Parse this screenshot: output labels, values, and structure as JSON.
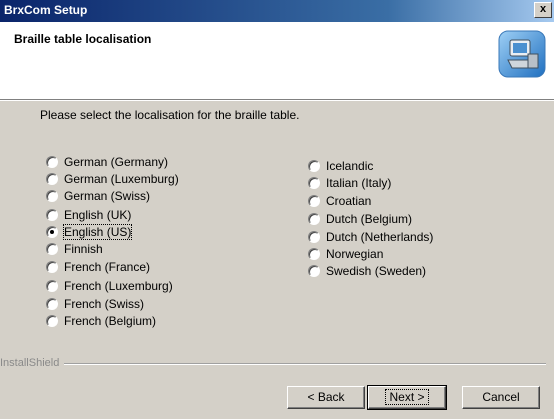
{
  "window": {
    "title": "BrxCom Setup",
    "close_label": "x"
  },
  "header": {
    "title": "Braille table localisation",
    "logo_icon": "installer-computer-icon"
  },
  "instruction": "Please select the localisation for the braille table.",
  "options_left": [
    {
      "label": "German (Germany)",
      "checked": false
    },
    {
      "label": "German (Luxemburg)",
      "checked": false
    },
    {
      "label": "German (Swiss)",
      "checked": false
    },
    {
      "label": "English (UK)",
      "checked": false
    },
    {
      "label": "English (US)",
      "checked": true
    },
    {
      "label": "Finnish",
      "checked": false
    },
    {
      "label": "French (France)",
      "checked": false
    },
    {
      "label": "French (Luxemburg)",
      "checked": false
    },
    {
      "label": "French (Swiss)",
      "checked": false
    },
    {
      "label": "French (Belgium)",
      "checked": false
    }
  ],
  "options_right": [
    {
      "label": "Icelandic",
      "checked": false
    },
    {
      "label": "Italian (Italy)",
      "checked": false
    },
    {
      "label": "Croatian",
      "checked": false
    },
    {
      "label": "Dutch (Belgium)",
      "checked": false
    },
    {
      "label": "Dutch (Netherlands)",
      "checked": false
    },
    {
      "label": "Norwegian",
      "checked": false
    },
    {
      "label": "Swedish (Sweden)",
      "checked": false
    }
  ],
  "footer": {
    "brand": "InstallShield",
    "back_label": "< Back",
    "next_label": "Next >",
    "cancel_label": "Cancel"
  },
  "colors": {
    "titlebar_start": "#0a246a",
    "titlebar_end": "#a6caf0",
    "face": "#d4d0c8"
  }
}
